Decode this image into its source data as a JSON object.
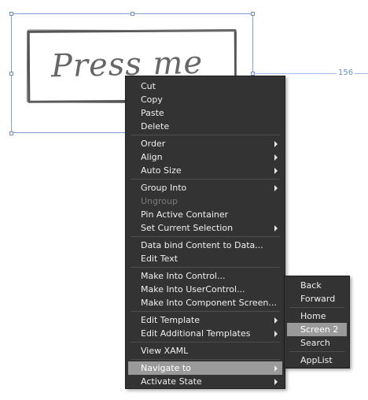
{
  "canvas": {
    "button_text": "Press me",
    "guide_value": "156"
  },
  "context_menu": {
    "items": [
      {
        "label": "Cut"
      },
      {
        "label": "Copy"
      },
      {
        "label": "Paste"
      },
      {
        "label": "Delete"
      },
      {
        "label": "Order",
        "submenu": true
      },
      {
        "label": "Align",
        "submenu": true
      },
      {
        "label": "Auto Size",
        "submenu": true
      },
      {
        "label": "Group Into",
        "submenu": true
      },
      {
        "label": "Ungroup",
        "disabled": true
      },
      {
        "label": "Pin Active Container"
      },
      {
        "label": "Set Current Selection",
        "submenu": true
      },
      {
        "label": "Data bind Content to Data..."
      },
      {
        "label": "Edit Text"
      },
      {
        "label": "Make Into Control..."
      },
      {
        "label": "Make Into UserControl..."
      },
      {
        "label": "Make Into Component Screen..."
      },
      {
        "label": "Edit Template",
        "submenu": true
      },
      {
        "label": "Edit Additional Templates",
        "submenu": true
      },
      {
        "label": "View XAML"
      },
      {
        "label": "Navigate to",
        "submenu": true,
        "highlighted": true
      },
      {
        "label": "Activate State",
        "submenu": true
      }
    ]
  },
  "navigate_submenu": {
    "items": [
      {
        "label": "Back"
      },
      {
        "label": "Forward"
      },
      {
        "label": "Home"
      },
      {
        "label": "Screen 2",
        "highlighted": true
      },
      {
        "label": "Search"
      },
      {
        "label": "AppList"
      }
    ]
  },
  "colors": {
    "menu_background": "#333333",
    "menu_highlight": "#9a9a9a",
    "selection_frame": "#7f9fd0"
  }
}
